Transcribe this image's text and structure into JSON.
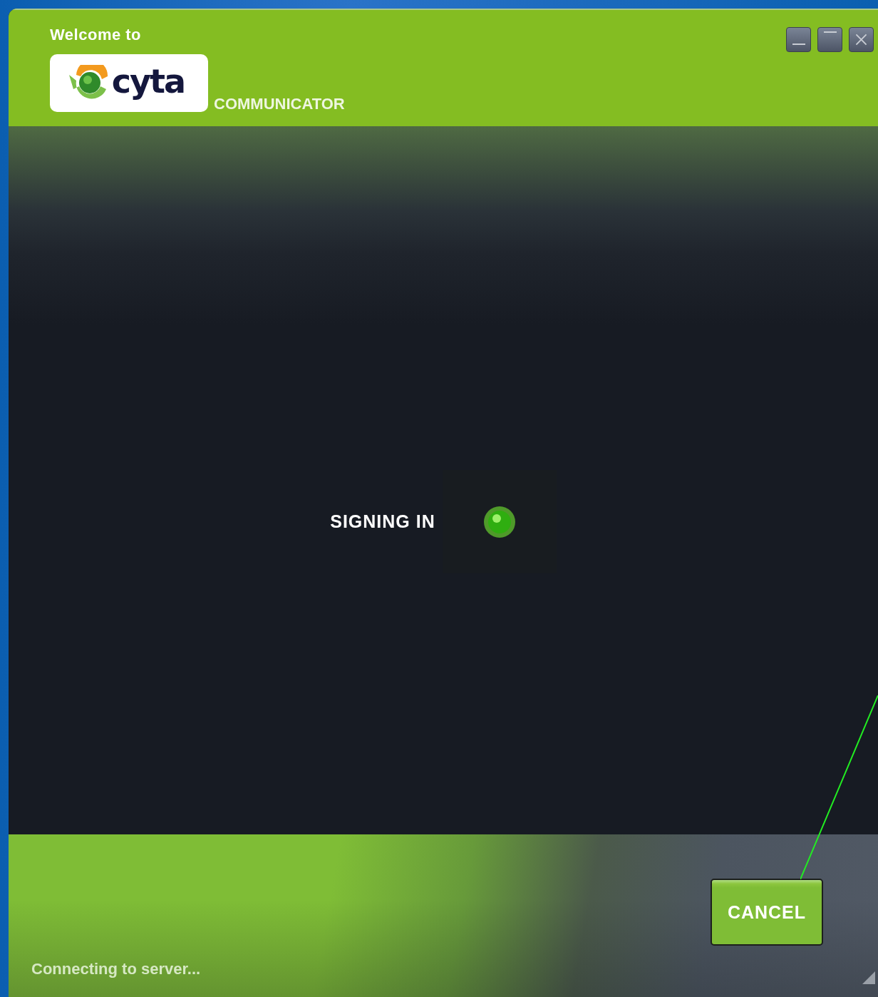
{
  "header": {
    "welcome": "Welcome to",
    "logo_text": "cyta",
    "product": "COMMUNICATOR"
  },
  "status": {
    "label": "SIGNING IN"
  },
  "footer": {
    "cancel_button": "CANCEL",
    "status_text": "Connecting to server..."
  }
}
